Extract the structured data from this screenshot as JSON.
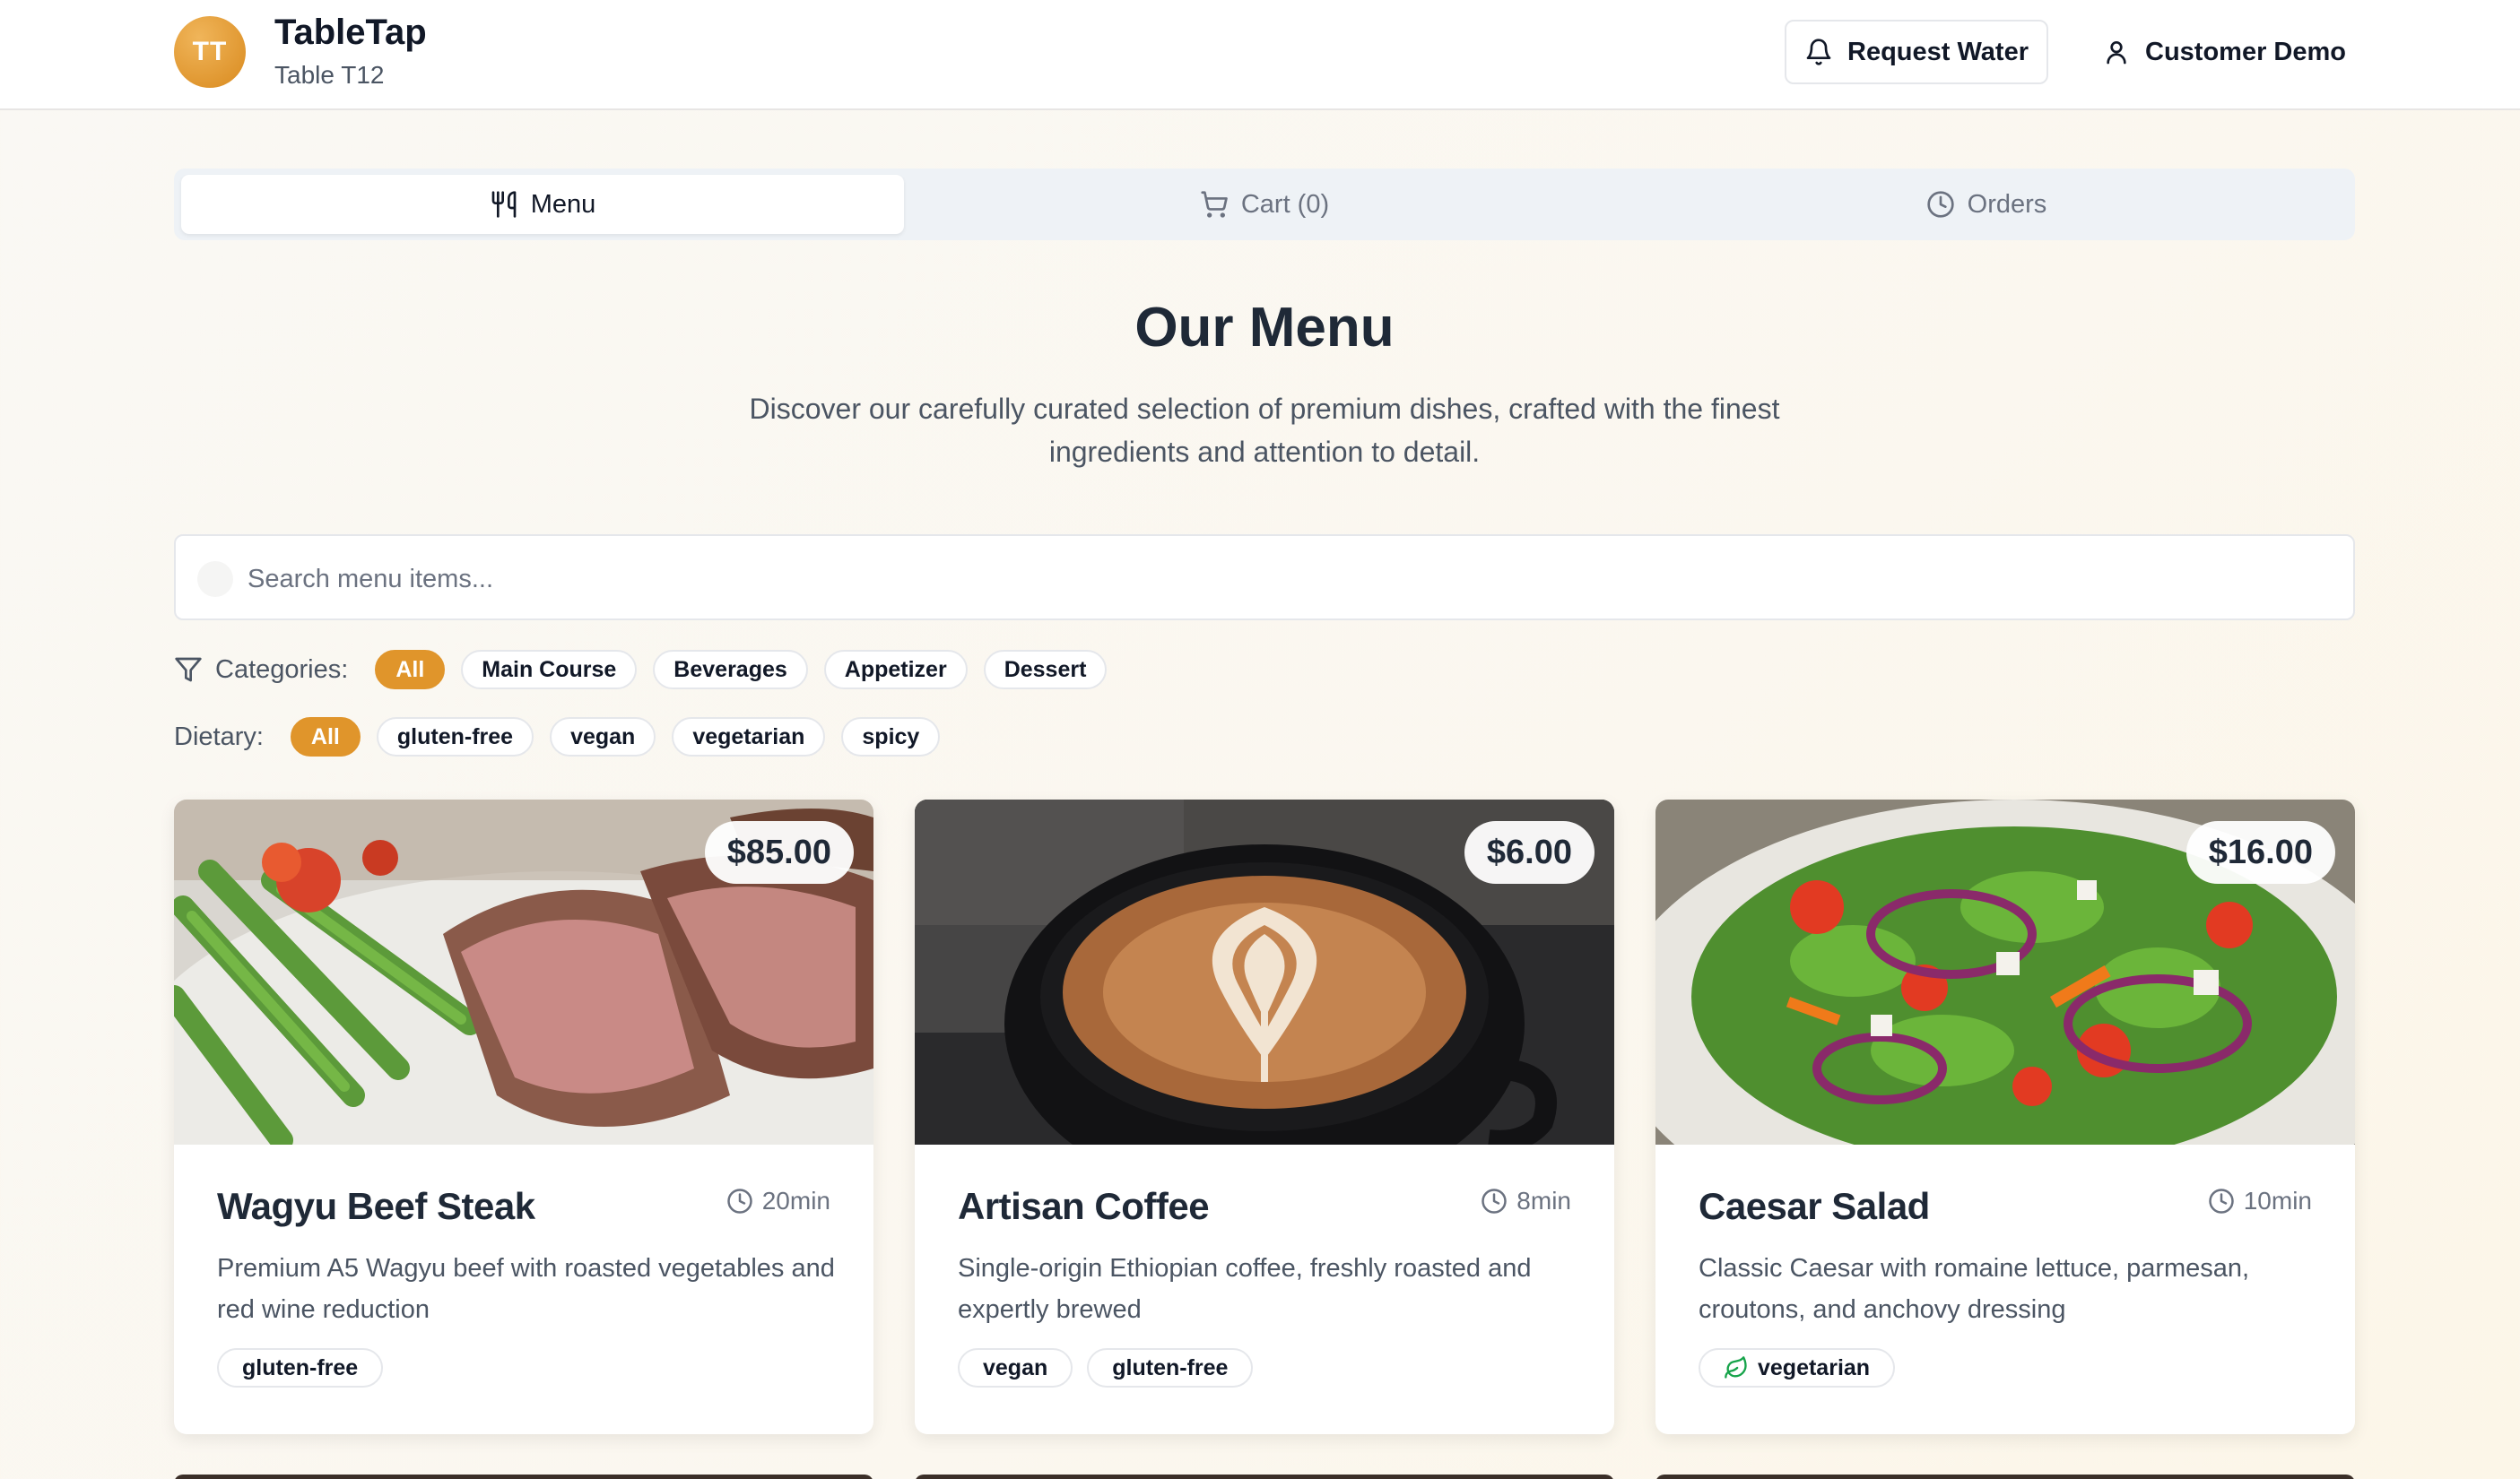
{
  "header": {
    "logo_initials": "TT",
    "brand_name": "TableTap",
    "table_label": "Table T12",
    "request_water_label": "Request Water",
    "user_label": "Customer Demo"
  },
  "tabs": [
    {
      "label": "Menu",
      "icon": "utensils-icon",
      "active": true
    },
    {
      "label": "Cart (0)",
      "icon": "cart-icon",
      "active": false
    },
    {
      "label": "Orders",
      "icon": "clock-icon",
      "active": false
    }
  ],
  "menu": {
    "title": "Our Menu",
    "description": "Discover our carefully curated selection of premium dishes, crafted with the finest ingredients and attention to detail."
  },
  "search": {
    "placeholder": "Search menu items...",
    "value": ""
  },
  "filters": {
    "categories_label": "Categories:",
    "categories": [
      "All",
      "Main Course",
      "Beverages",
      "Appetizer",
      "Dessert"
    ],
    "categories_selected": "All",
    "dietary_label": "Dietary:",
    "dietary": [
      "All",
      "gluten-free",
      "vegan",
      "vegetarian",
      "spicy"
    ],
    "dietary_selected": "All"
  },
  "items": [
    {
      "name": "Wagyu Beef Steak",
      "price": "$85.00",
      "time": "20min",
      "description": "Premium A5 Wagyu beef with roasted vegetables and red wine reduction",
      "tags": [
        "gluten-free"
      ]
    },
    {
      "name": "Artisan Coffee",
      "price": "$6.00",
      "time": "8min",
      "description": "Single-origin Ethiopian coffee, freshly roasted and expertly brewed",
      "tags": [
        "vegan",
        "gluten-free"
      ]
    },
    {
      "name": "Caesar Salad",
      "price": "$16.00",
      "time": "10min",
      "description": "Classic Caesar with romaine lettuce, parmesan, croutons, and anchovy dressing",
      "tags": [
        "vegetarian"
      ],
      "tag_icon": "leaf-icon"
    }
  ],
  "colors": {
    "accent": "#e0952b",
    "background": "#faf8f4",
    "text": "#1f2937",
    "muted": "#6b7280"
  }
}
